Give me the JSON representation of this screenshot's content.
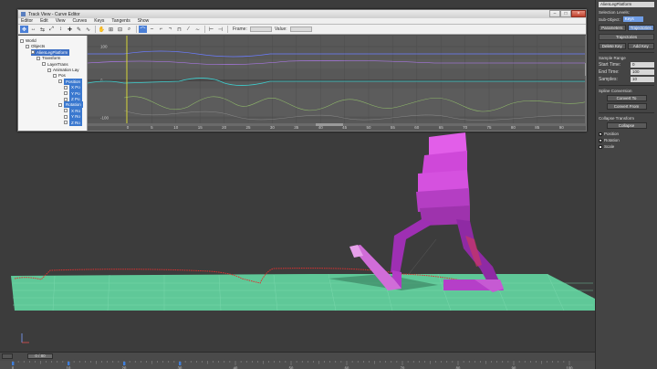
{
  "window": {
    "title": "Track View - Curve Editor",
    "controls": {
      "minimize": "–",
      "maximize": "□",
      "close": "×"
    }
  },
  "menu": [
    "Editor",
    "Edit",
    "View",
    "Curves",
    "Keys",
    "Tangents",
    "Show"
  ],
  "toolbar": {
    "frame_label": "Frame:",
    "value_label": "Value:"
  },
  "tree": {
    "items": [
      {
        "label": "World",
        "depth": 0
      },
      {
        "label": "Objects",
        "depth": 1
      },
      {
        "label": "AlienLegPlatform",
        "depth": 2,
        "selected": true
      },
      {
        "label": "Transform",
        "depth": 3
      },
      {
        "label": "LayerTrans",
        "depth": 4
      },
      {
        "label": "Animation Lay",
        "depth": 5
      },
      {
        "label": "Pos",
        "depth": 6
      },
      {
        "label": "Position",
        "depth": 7,
        "box": true
      },
      {
        "label": "X Po",
        "depth": 8,
        "box": true
      },
      {
        "label": "Y Po",
        "depth": 8,
        "box": true
      },
      {
        "label": "Z Po",
        "depth": 8,
        "box": true
      },
      {
        "label": "Rotation",
        "depth": 7,
        "box": true
      },
      {
        "label": "X Ro",
        "depth": 8,
        "box": true
      },
      {
        "label": "Y Ro",
        "depth": 8,
        "box": true
      },
      {
        "label": "Z Ro",
        "depth": 8,
        "box": true
      }
    ]
  },
  "graph": {
    "y_ticks": [
      "100",
      "0",
      "-100"
    ],
    "x_ticks": [
      "0",
      "5",
      "10",
      "15",
      "20",
      "25",
      "30",
      "35",
      "40",
      "45",
      "50",
      "55",
      "60",
      "65",
      "70",
      "75",
      "80",
      "85",
      "90"
    ]
  },
  "panel": {
    "object_name": "AlienLegPlatform",
    "selection_levels_label": "Selection Levels:",
    "sub_object_label": "Sub-Object:",
    "sub_object_value": "Keys",
    "tabs": [
      "Parameters",
      "Trajectories"
    ],
    "trajectories_rollout": "Trajectories",
    "delete_key": "Delete Key",
    "add_key": "Add Key",
    "sample_range_label": "Sample Range",
    "start_time_label": "Start Time:",
    "start_time_value": "0",
    "end_time_label": "End Time:",
    "end_time_value": "100",
    "samples_label": "Samples:",
    "samples_value": "10",
    "spline_conversion_label": "Spline Conversion",
    "convert_to": "Convert To",
    "convert_from": "Convert From",
    "collapse_transform_label": "Collapse Transform",
    "collapse_button": "Collapse",
    "checks": [
      {
        "label": "Position",
        "checked": true
      },
      {
        "label": "Rotation",
        "checked": true
      },
      {
        "label": "Scale",
        "checked": false
      }
    ]
  },
  "timebar": {
    "slider_text": "0 / 80",
    "ticks": [
      "0",
      "10",
      "20",
      "30",
      "40",
      "50",
      "60",
      "70",
      "80",
      "90",
      "100"
    ]
  },
  "colors": {
    "ground": "#5fc898",
    "character": "#c33fd1",
    "trajectory": "#e03030"
  }
}
